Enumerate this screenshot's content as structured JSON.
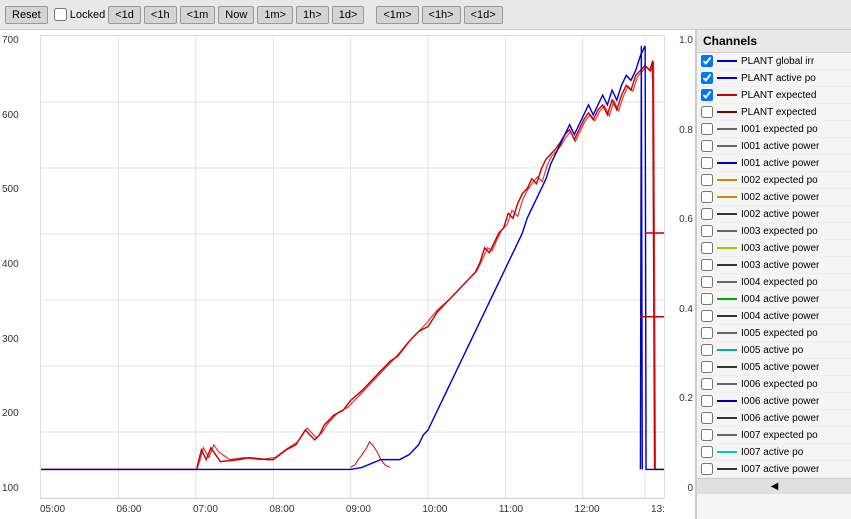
{
  "toolbar": {
    "reset_label": "Reset",
    "locked_label": "Locked",
    "buttons": [
      "<1d",
      "<1h",
      "<1m",
      "Now",
      "1m>",
      "1h>",
      "1d>",
      "<1m>",
      "<1h>",
      "<1d>"
    ]
  },
  "chart": {
    "y_axis_left": [
      "700",
      "600",
      "500",
      "400",
      "300",
      "200",
      "100"
    ],
    "y_axis_right": [
      "1.0",
      "0.8",
      "0.6",
      "0.4",
      "0.2",
      "0"
    ],
    "x_axis": [
      "05:00",
      "06:00",
      "07:00",
      "08:00",
      "09:00",
      "10:00",
      "11:00",
      "12:00",
      "13:"
    ]
  },
  "channels": {
    "title": "Channels",
    "items": [
      {
        "label": "PLANT global irr",
        "color": "#0000cd",
        "checked": true,
        "style": "solid"
      },
      {
        "label": "PLANT active po",
        "color": "#0000cd",
        "checked": true,
        "style": "solid"
      },
      {
        "label": "PLANT expected",
        "color": "#cc0000",
        "checked": true,
        "style": "solid"
      },
      {
        "label": "PLANT expected",
        "color": "#8b0000",
        "checked": false,
        "style": "solid"
      },
      {
        "label": "I001 expected po",
        "color": "#666",
        "checked": false,
        "style": "solid"
      },
      {
        "label": "I001 active power",
        "color": "#666",
        "checked": false,
        "style": "solid"
      },
      {
        "label": "I001 active power",
        "color": "#0000cd",
        "checked": false,
        "style": "solid"
      },
      {
        "label": "I002 expected po",
        "color": "#cc8800",
        "checked": false,
        "style": "solid"
      },
      {
        "label": "I002 active power",
        "color": "#cc8800",
        "checked": false,
        "style": "solid"
      },
      {
        "label": "I002 active power",
        "color": "#333",
        "checked": false,
        "style": "solid"
      },
      {
        "label": "I003 expected po",
        "color": "#666",
        "checked": false,
        "style": "solid"
      },
      {
        "label": "I003 active power",
        "color": "#99cc00",
        "checked": false,
        "style": "solid"
      },
      {
        "label": "I003 active power",
        "color": "#333",
        "checked": false,
        "style": "solid"
      },
      {
        "label": "I004 expected po",
        "color": "#666",
        "checked": false,
        "style": "solid"
      },
      {
        "label": "I004 active power",
        "color": "#00aa00",
        "checked": false,
        "style": "solid"
      },
      {
        "label": "I004 active power",
        "color": "#333",
        "checked": false,
        "style": "solid"
      },
      {
        "label": "I005 expected po",
        "color": "#666",
        "checked": false,
        "style": "solid"
      },
      {
        "label": "I005 active po",
        "color": "#00aaaa",
        "checked": false,
        "style": "solid"
      },
      {
        "label": "I005 active power",
        "color": "#333",
        "checked": false,
        "style": "solid"
      },
      {
        "label": "I006 expected po",
        "color": "#666",
        "checked": false,
        "style": "solid"
      },
      {
        "label": "I006 active power",
        "color": "#0000aa",
        "checked": false,
        "style": "solid"
      },
      {
        "label": "I006 active power",
        "color": "#333",
        "checked": false,
        "style": "solid"
      },
      {
        "label": "I007 expected po",
        "color": "#666",
        "checked": false,
        "style": "solid"
      },
      {
        "label": "I007 active po",
        "color": "#00cccc",
        "checked": false,
        "style": "solid"
      },
      {
        "label": "I007 active power",
        "color": "#333",
        "checked": false,
        "style": "solid"
      }
    ]
  }
}
